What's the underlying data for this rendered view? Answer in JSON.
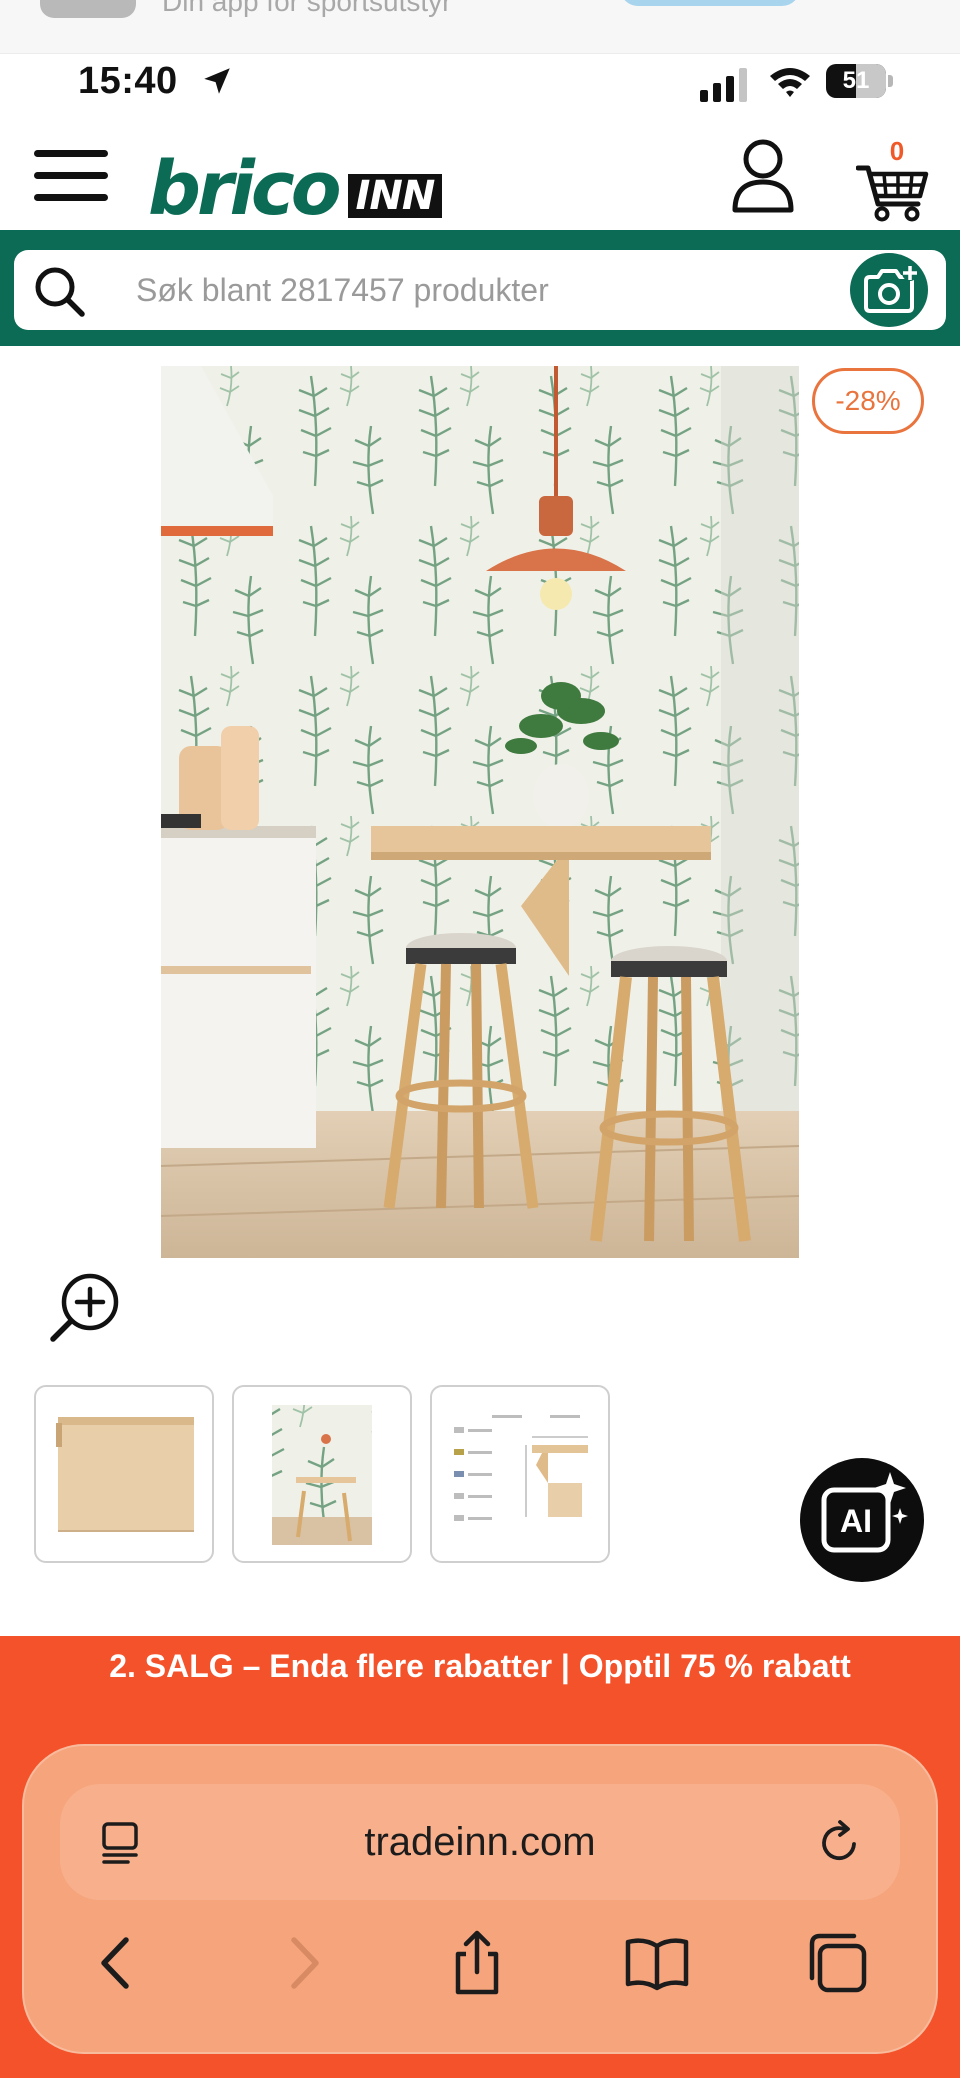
{
  "notification": {
    "text": "Din app for sportsutstyr"
  },
  "status_bar": {
    "time": "15:40",
    "battery": "51"
  },
  "header": {
    "logo_main": "brico",
    "logo_suffix": "INN",
    "cart_count": "0"
  },
  "search": {
    "placeholder": "Søk blant 2817457 produkter"
  },
  "product": {
    "discount": "-28%"
  },
  "promo": {
    "text": "2. SALG – Enda flere rabatter | Opptil 75 % rabatt"
  },
  "browser": {
    "url": "tradeinn.com"
  },
  "ai_button": {
    "label": "AI"
  },
  "colors": {
    "brand_green": "#0b6b55",
    "accent_orange": "#f4522a",
    "badge_orange": "#e9743e",
    "safari_bar": "#f6a47c"
  }
}
